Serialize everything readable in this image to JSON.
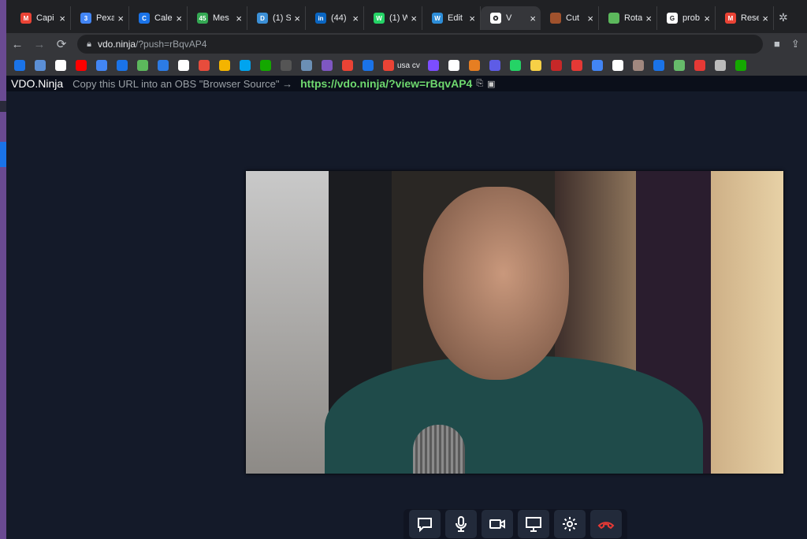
{
  "tabs": [
    {
      "title": "Capi",
      "favicon": "M",
      "color": "#ea4335"
    },
    {
      "title": "Pexa",
      "favicon": "3",
      "color": "#4285f4"
    },
    {
      "title": "Cale",
      "favicon": "C",
      "color": "#1a73e8"
    },
    {
      "title": "Mes",
      "favicon": "45",
      "color": "#34a853"
    },
    {
      "title": "(1) S",
      "favicon": "D",
      "color": "#3b8fd6"
    },
    {
      "title": "(44)",
      "favicon": "in",
      "color": "#0a66c2"
    },
    {
      "title": "(1) W",
      "favicon": "W",
      "color": "#25d366"
    },
    {
      "title": "Edit",
      "favicon": "W",
      "color": "#2d8dd8"
    },
    {
      "title": "V",
      "favicon": "✪",
      "color": "#ffffff",
      "active": true
    },
    {
      "title": "Cut",
      "favicon": "",
      "color": "#a0522d"
    },
    {
      "title": "Rota",
      "favicon": "",
      "color": "#5cb85c"
    },
    {
      "title": "prob",
      "favicon": "G",
      "color": "#ffffff"
    },
    {
      "title": "Rese",
      "favicon": "M",
      "color": "#ea4335"
    }
  ],
  "address_bar": {
    "host": "vdo.ninja",
    "path": "/?push=rBqvAP4"
  },
  "bookmarks": [
    {
      "color": "#1a73e8"
    },
    {
      "color": "#5b8fd6"
    },
    {
      "color": "#ffffff"
    },
    {
      "color": "#ff0000"
    },
    {
      "color": "#4285f4"
    },
    {
      "color": "#1a73e8"
    },
    {
      "color": "#5cb85c"
    },
    {
      "color": "#2c7be5"
    },
    {
      "color": "#ffffff"
    },
    {
      "color": "#e74c3c"
    },
    {
      "color": "#f4b400"
    },
    {
      "color": "#00a4ef"
    },
    {
      "color": "#14a800"
    },
    {
      "color": "#555555"
    },
    {
      "color": "#6b8fb5"
    },
    {
      "color": "#7e57c2"
    },
    {
      "color": "#ea4335"
    },
    {
      "color": "#1a73e8"
    },
    {
      "color": "#ea4335",
      "label": "usa cv"
    },
    {
      "color": "#7c4dff"
    },
    {
      "color": "#ffffff"
    },
    {
      "color": "#e67e22"
    },
    {
      "color": "#5e5ce6"
    },
    {
      "color": "#25d366"
    },
    {
      "color": "#f7d046"
    },
    {
      "color": "#c62828"
    },
    {
      "color": "#e53935"
    },
    {
      "color": "#4285f4"
    },
    {
      "color": "#ffffff"
    },
    {
      "color": "#a1887f"
    },
    {
      "color": "#1a73e8"
    },
    {
      "color": "#66bb6a"
    },
    {
      "color": "#e53935"
    },
    {
      "color": "#bbbbbb"
    },
    {
      "color": "#14a800"
    }
  ],
  "vdo": {
    "brand": "VDO.Ninja",
    "hint": "Copy this URL into an OBS \"Browser Source\" →",
    "view_link": "https://vdo.ninja/?view=rBqvAP4"
  },
  "controls": [
    {
      "name": "chat-button",
      "icon": "chat-icon",
      "color": "#ffffff"
    },
    {
      "name": "microphone-button",
      "icon": "microphone-icon",
      "color": "#ffffff"
    },
    {
      "name": "camera-button",
      "icon": "camera-icon",
      "color": "#ffffff"
    },
    {
      "name": "screenshare-button",
      "icon": "screen-icon",
      "color": "#ffffff"
    },
    {
      "name": "settings-button",
      "icon": "gear-icon",
      "color": "#ffffff"
    },
    {
      "name": "hangup-button",
      "icon": "hangup-icon",
      "color": "#e53935"
    }
  ]
}
